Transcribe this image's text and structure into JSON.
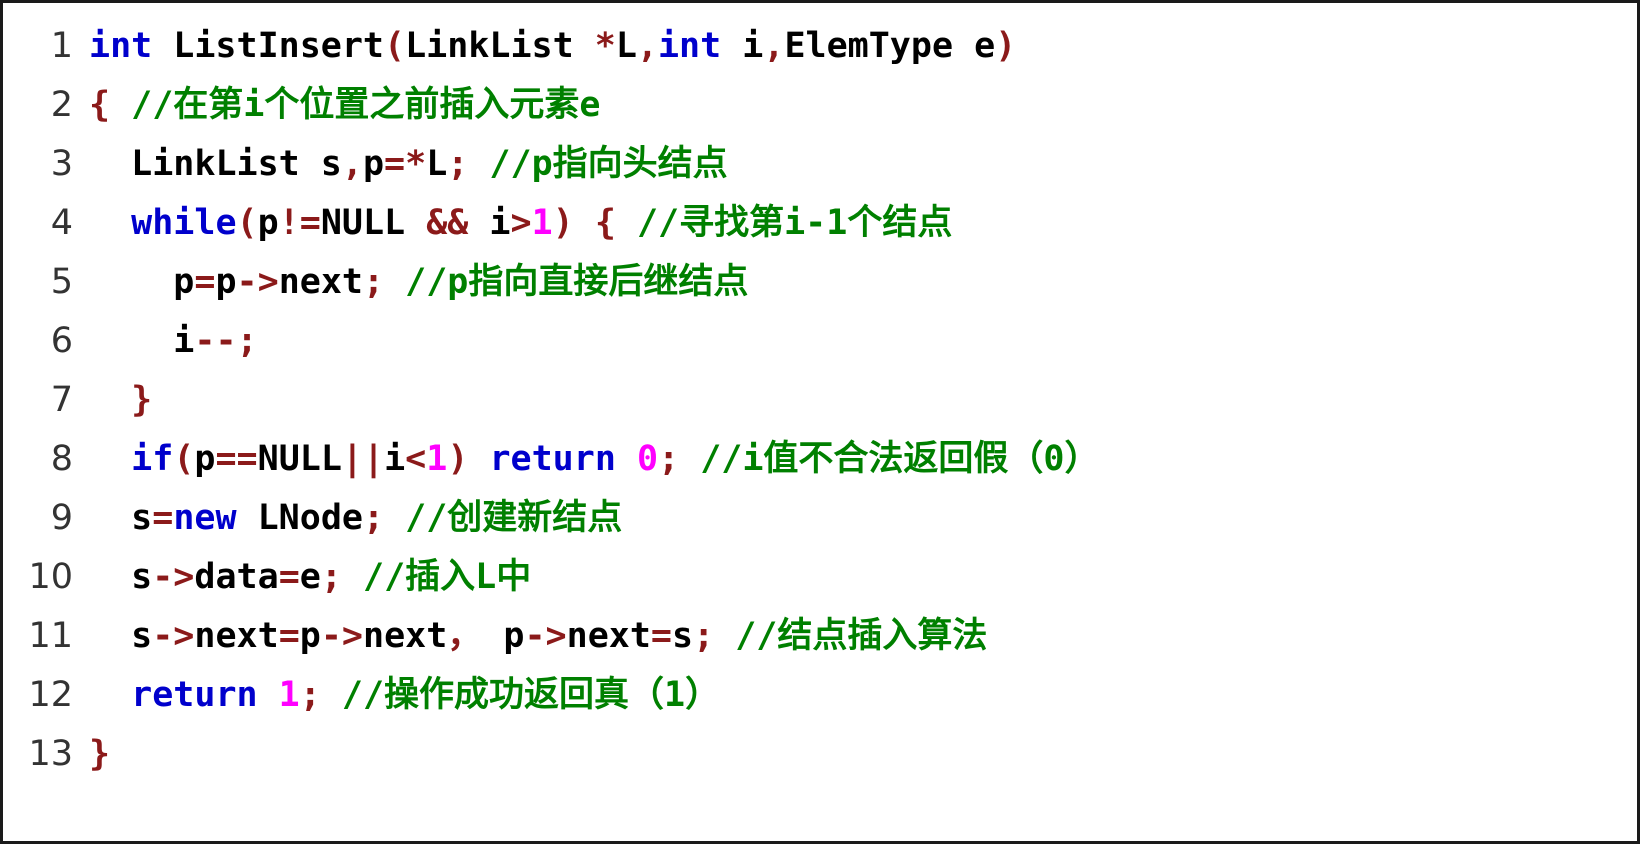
{
  "document": {
    "kind": "source-code-listing",
    "language": "C++",
    "function_name": "ListInsert",
    "total_lines": 13
  },
  "colors": {
    "background": "#ffffff",
    "border": "#1a1a1a",
    "line_number": "#333333",
    "keyword": "#0000CC",
    "comment": "#008000",
    "punctuation": "#8B1A1A",
    "number": "#FF00FF",
    "identifier": "#000000"
  },
  "lines": [
    {
      "number": "1",
      "tokens": [
        {
          "t": "kw",
          "v": "int"
        },
        {
          "t": "id",
          "v": " ListInsert"
        },
        {
          "t": "pun",
          "v": "("
        },
        {
          "t": "id",
          "v": "LinkList "
        },
        {
          "t": "pun",
          "v": "*"
        },
        {
          "t": "id",
          "v": "L"
        },
        {
          "t": "pun",
          "v": ","
        },
        {
          "t": "kw",
          "v": "int"
        },
        {
          "t": "id",
          "v": " i"
        },
        {
          "t": "pun",
          "v": ","
        },
        {
          "t": "id",
          "v": "ElemType e"
        },
        {
          "t": "pun",
          "v": ")"
        }
      ]
    },
    {
      "number": "2",
      "tokens": [
        {
          "t": "pun",
          "v": "{"
        },
        {
          "t": "id",
          "v": " "
        },
        {
          "t": "cmt",
          "v": "//在第i个位置之前插入元素e"
        }
      ]
    },
    {
      "number": "3",
      "tokens": [
        {
          "t": "ws",
          "v": "  "
        },
        {
          "t": "id",
          "v": "LinkList s"
        },
        {
          "t": "pun",
          "v": ","
        },
        {
          "t": "id",
          "v": "p"
        },
        {
          "t": "pun",
          "v": "=*"
        },
        {
          "t": "id",
          "v": "L"
        },
        {
          "t": "pun",
          "v": ";"
        },
        {
          "t": "id",
          "v": " "
        },
        {
          "t": "cmt",
          "v": "//p指向头结点"
        }
      ]
    },
    {
      "number": "4",
      "tokens": [
        {
          "t": "ws",
          "v": "  "
        },
        {
          "t": "kw",
          "v": "while"
        },
        {
          "t": "pun",
          "v": "("
        },
        {
          "t": "id",
          "v": "p"
        },
        {
          "t": "pun",
          "v": "!="
        },
        {
          "t": "id",
          "v": "NULL "
        },
        {
          "t": "pun",
          "v": "&&"
        },
        {
          "t": "id",
          "v": " i"
        },
        {
          "t": "pun",
          "v": ">"
        },
        {
          "t": "num",
          "v": "1"
        },
        {
          "t": "pun",
          "v": ")"
        },
        {
          "t": "id",
          "v": " "
        },
        {
          "t": "pun",
          "v": "{"
        },
        {
          "t": "id",
          "v": " "
        },
        {
          "t": "cmt",
          "v": "//寻找第i-1个结点"
        }
      ]
    },
    {
      "number": "5",
      "tokens": [
        {
          "t": "ws",
          "v": "    "
        },
        {
          "t": "id",
          "v": "p"
        },
        {
          "t": "pun",
          "v": "="
        },
        {
          "t": "id",
          "v": "p"
        },
        {
          "t": "pun",
          "v": "->"
        },
        {
          "t": "id",
          "v": "next"
        },
        {
          "t": "pun",
          "v": ";"
        },
        {
          "t": "id",
          "v": " "
        },
        {
          "t": "cmt",
          "v": "//p指向直接后继结点"
        }
      ]
    },
    {
      "number": "6",
      "tokens": [
        {
          "t": "ws",
          "v": "    "
        },
        {
          "t": "id",
          "v": "i"
        },
        {
          "t": "pun",
          "v": "--;"
        }
      ]
    },
    {
      "number": "7",
      "tokens": [
        {
          "t": "ws",
          "v": "  "
        },
        {
          "t": "pun",
          "v": "}"
        }
      ]
    },
    {
      "number": "8",
      "tokens": [
        {
          "t": "ws",
          "v": "  "
        },
        {
          "t": "kw",
          "v": "if"
        },
        {
          "t": "pun",
          "v": "("
        },
        {
          "t": "id",
          "v": "p"
        },
        {
          "t": "pun",
          "v": "=="
        },
        {
          "t": "id",
          "v": "NULL"
        },
        {
          "t": "pun",
          "v": "||"
        },
        {
          "t": "id",
          "v": "i"
        },
        {
          "t": "pun",
          "v": "<"
        },
        {
          "t": "num",
          "v": "1"
        },
        {
          "t": "pun",
          "v": ")"
        },
        {
          "t": "id",
          "v": " "
        },
        {
          "t": "kw",
          "v": "return"
        },
        {
          "t": "id",
          "v": " "
        },
        {
          "t": "num",
          "v": "0"
        },
        {
          "t": "pun",
          "v": ";"
        },
        {
          "t": "id",
          "v": " "
        },
        {
          "t": "cmt",
          "v": "//i值不合法返回假（0）"
        }
      ]
    },
    {
      "number": "9",
      "tokens": [
        {
          "t": "ws",
          "v": "  "
        },
        {
          "t": "id",
          "v": "s"
        },
        {
          "t": "pun",
          "v": "="
        },
        {
          "t": "kw",
          "v": "new"
        },
        {
          "t": "id",
          "v": " LNode"
        },
        {
          "t": "pun",
          "v": ";"
        },
        {
          "t": "id",
          "v": " "
        },
        {
          "t": "cmt",
          "v": "//创建新结点"
        }
      ]
    },
    {
      "number": "10",
      "tokens": [
        {
          "t": "ws",
          "v": "  "
        },
        {
          "t": "id",
          "v": "s"
        },
        {
          "t": "pun",
          "v": "->"
        },
        {
          "t": "id",
          "v": "data"
        },
        {
          "t": "pun",
          "v": "="
        },
        {
          "t": "id",
          "v": "e"
        },
        {
          "t": "pun",
          "v": ";"
        },
        {
          "t": "id",
          "v": " "
        },
        {
          "t": "cmt",
          "v": "//插入L中"
        }
      ]
    },
    {
      "number": "11",
      "tokens": [
        {
          "t": "ws",
          "v": "  "
        },
        {
          "t": "id",
          "v": "s"
        },
        {
          "t": "pun",
          "v": "->"
        },
        {
          "t": "id",
          "v": "next"
        },
        {
          "t": "pun",
          "v": "="
        },
        {
          "t": "id",
          "v": "p"
        },
        {
          "t": "pun",
          "v": "->"
        },
        {
          "t": "id",
          "v": "next"
        },
        {
          "t": "pun",
          "v": "，"
        },
        {
          "t": "id",
          "v": " p"
        },
        {
          "t": "pun",
          "v": "->"
        },
        {
          "t": "id",
          "v": "next"
        },
        {
          "t": "pun",
          "v": "="
        },
        {
          "t": "id",
          "v": "s"
        },
        {
          "t": "pun",
          "v": ";"
        },
        {
          "t": "id",
          "v": " "
        },
        {
          "t": "cmt",
          "v": "//结点插入算法"
        }
      ]
    },
    {
      "number": "12",
      "tokens": [
        {
          "t": "ws",
          "v": "  "
        },
        {
          "t": "kw",
          "v": "return"
        },
        {
          "t": "id",
          "v": " "
        },
        {
          "t": "num",
          "v": "1"
        },
        {
          "t": "pun",
          "v": ";"
        },
        {
          "t": "id",
          "v": " "
        },
        {
          "t": "cmt",
          "v": "//操作成功返回真（1）"
        }
      ]
    },
    {
      "number": "13",
      "tokens": [
        {
          "t": "pun",
          "v": "}"
        }
      ]
    }
  ]
}
